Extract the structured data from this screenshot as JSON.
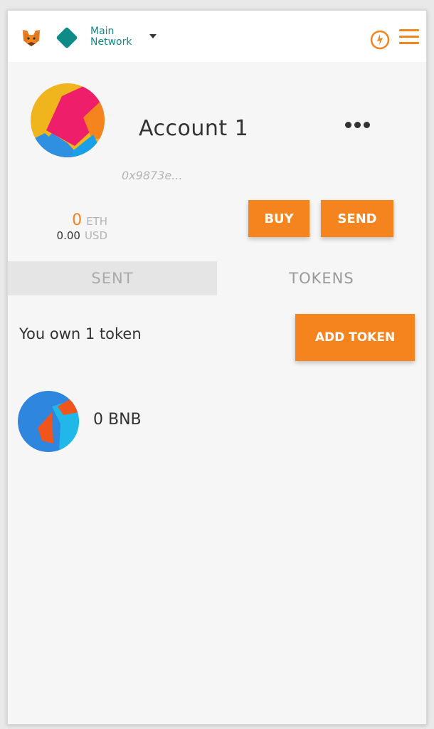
{
  "header": {
    "network_line1": "Main",
    "network_line2": "Network",
    "fox_icon": "metamask-fox-icon",
    "notification_icon": "notification-icon",
    "menu_icon": "hamburger-menu-icon"
  },
  "account": {
    "name": "Account 1",
    "address": "0x9873e..."
  },
  "balance": {
    "eth_amount": "0",
    "eth_unit": "ETH",
    "usd_amount": "0.00",
    "usd_unit": "USD"
  },
  "actions": {
    "buy_label": "BUY",
    "send_label": "SEND"
  },
  "tabs": [
    {
      "label": "SENT",
      "active": false
    },
    {
      "label": "TOKENS",
      "active": true
    }
  ],
  "tokens": {
    "summary": "You own 1 token",
    "add_label": "ADD TOKEN",
    "items": [
      {
        "balance": "0 BNB"
      }
    ]
  },
  "colors": {
    "accent": "#f5841f",
    "network": "#0f8b87"
  }
}
